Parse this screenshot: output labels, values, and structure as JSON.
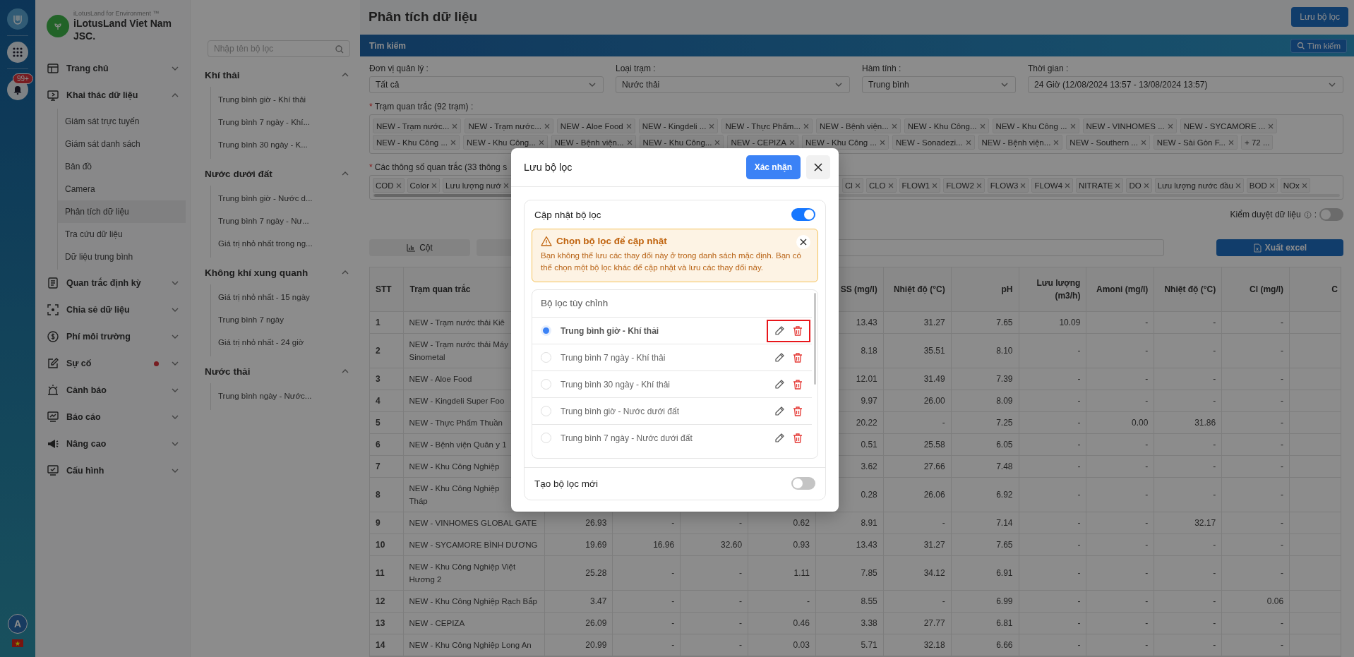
{
  "rail": {
    "badge": "99+",
    "avatar": "A"
  },
  "brand": {
    "tagline": "iLotusLand for Environment ™",
    "name": "iLotusLand Viet Nam JSC."
  },
  "nav": [
    {
      "label": "Trang chủ",
      "expanded": false,
      "alert": false
    },
    {
      "label": "Khai thác dữ liệu",
      "expanded": true,
      "alert": false,
      "children": [
        {
          "label": "Giám sát trực tuyến",
          "selected": false
        },
        {
          "label": "Giám sát danh sách",
          "selected": false
        },
        {
          "label": "Bản đồ",
          "selected": false
        },
        {
          "label": "Camera",
          "selected": false
        },
        {
          "label": "Phân tích dữ liệu",
          "selected": true
        },
        {
          "label": "Tra cứu dữ liệu",
          "selected": false
        },
        {
          "label": "Dữ liệu trung bình",
          "selected": false
        }
      ]
    },
    {
      "label": "Quan trắc định kỳ",
      "expanded": false,
      "alert": false
    },
    {
      "label": "Chia sẻ dữ liệu",
      "expanded": false,
      "alert": false
    },
    {
      "label": "Phí môi trường",
      "expanded": false,
      "alert": false
    },
    {
      "label": "Sự cố",
      "expanded": false,
      "alert": true
    },
    {
      "label": "Cảnh báo",
      "expanded": false,
      "alert": false
    },
    {
      "label": "Báo cáo",
      "expanded": false,
      "alert": false
    },
    {
      "label": "Nâng cao",
      "expanded": false,
      "alert": false
    },
    {
      "label": "Cấu hình",
      "expanded": false,
      "alert": false
    }
  ],
  "filter_panel": {
    "placeholder": "Nhập tên bộ lọc",
    "groups": [
      {
        "title": "Khí thải",
        "expanded": true,
        "items": [
          "Trung bình giờ - Khí thải",
          "Trung bình 7 ngày - Khí...",
          "Trung bình 30 ngày - K..."
        ]
      },
      {
        "title": "Nước dưới đất",
        "expanded": true,
        "items": [
          "Trung bình giờ - Nước d...",
          "Trung bình 7 ngày - Nư...",
          "Giá trị nhỏ nhất trong ng..."
        ]
      },
      {
        "title": "Không khí xung quanh",
        "expanded": true,
        "items": [
          "Giá trị nhỏ nhất - 15 ngày",
          "Trung bình 7 ngày",
          "Giá trị nhỏ nhất - 24 giờ"
        ]
      },
      {
        "title": "Nước thải",
        "expanded": true,
        "items": [
          "Trung bình ngày - Nước..."
        ]
      }
    ]
  },
  "header": {
    "title": "Phân tích dữ liệu",
    "save_button": "Lưu bộ lọc"
  },
  "search_bar": {
    "title": "Tìm kiếm",
    "button": "Tìm kiếm"
  },
  "form": {
    "fields": [
      {
        "label": "Đơn vị quản lý :",
        "value": "Tất cả"
      },
      {
        "label": "Loại trạm :",
        "value": "Nước thải"
      },
      {
        "label": "Hàm tính :",
        "value": "Trung bình"
      },
      {
        "label": "Thời gian :",
        "value": "24 Giờ (12/08/2024 13:57 - 13/08/2024 13:57)"
      }
    ],
    "stations": {
      "mark": "*",
      "label": "Trạm quan trắc (92 trạm) :",
      "chip_rows": [
        [
          "NEW - Trạm nước...",
          "NEW - Trạm nước...",
          "NEW - Aloe Food",
          "NEW - Kingdeli ...",
          "NEW - Thực Phẩm...",
          "NEW - Bệnh viện...",
          "NEW - Khu Công...",
          "NEW - Khu Công ...",
          "NEW - VINHOMES ...",
          "NEW - SYCAMORE ..."
        ],
        [
          "NEW - Khu Công ...",
          "NEW - Khu Công...",
          "NEW - Bệnh viện...",
          "NEW - Khu Công...",
          "NEW - CEPIZA",
          "NEW - Khu Công ...",
          "NEW - Sonadezi...",
          "NEW - Bệnh viện...",
          "NEW - Southern ...",
          "NEW - Sài Gòn F..."
        ]
      ],
      "more": "+ 72 ..."
    },
    "parameters": {
      "mark": "*",
      "label": "Các thông số quan trắc (33 thông s",
      "chips_left": [
        "COD",
        "Color",
        "Lưu lượng nướ"
      ],
      "chips_right": [
        "Cl",
        "CLO",
        "FLOW1",
        "FLOW2",
        "FLOW3",
        "FLOW4",
        "NITRATE",
        "DO",
        "Lưu lượng nước đầu",
        "BOD",
        "NOx"
      ]
    },
    "review": {
      "label": "Kiểm duyệt dữ liệu",
      "colon": ":",
      "on": false
    }
  },
  "toolbar": {
    "column_button": "Cột",
    "export_button": "Xuất excel"
  },
  "table": {
    "columns": [
      "STT",
      "Trạm quan trắc",
      null,
      null,
      null,
      null,
      "SS (mg/l)",
      "Nhiệt độ (°C)",
      "pH",
      "Lưu lượng (m3/h)",
      "Amoni (mg/l)",
      "Nhiệt độ (°C)",
      "Cl (mg/l)",
      "C"
    ],
    "rows": [
      [
        "1",
        "NEW - Trạm nước thải Kiê",
        null,
        null,
        null,
        null,
        "13.43",
        "31.27",
        "7.65",
        "10.09",
        "-",
        "-",
        "-",
        null
      ],
      [
        "2",
        "NEW - Trạm nước thải Máy\nSinometal",
        null,
        null,
        null,
        null,
        "8.18",
        "35.51",
        "8.10",
        "-",
        "-",
        "-",
        "-",
        null
      ],
      [
        "3",
        "NEW - Aloe Food",
        null,
        null,
        null,
        null,
        "12.01",
        "31.49",
        "7.39",
        "-",
        "-",
        "-",
        "-",
        null
      ],
      [
        "4",
        "NEW - Kingdeli Super Foo",
        null,
        null,
        null,
        null,
        "9.97",
        "26.00",
        "8.09",
        "-",
        "-",
        "-",
        "-",
        null
      ],
      [
        "5",
        "NEW - Thực Phẩm Thuần",
        null,
        null,
        null,
        null,
        "20.22",
        "-",
        "7.25",
        "-",
        "0.00",
        "31.86",
        "-",
        null
      ],
      [
        "6",
        "NEW - Bệnh viện Quân y 1",
        null,
        null,
        null,
        null,
        "0.51",
        "25.58",
        "6.05",
        "-",
        "-",
        "-",
        "-",
        null
      ],
      [
        "7",
        "NEW - Khu Công Nghiệp",
        null,
        null,
        null,
        null,
        "3.62",
        "27.66",
        "7.48",
        "-",
        "-",
        "-",
        "-",
        null
      ],
      [
        "8",
        "NEW - Khu Công Nghiệp\nTháp",
        null,
        null,
        null,
        null,
        "0.28",
        "26.06",
        "6.92",
        "-",
        "-",
        "-",
        "-",
        null
      ],
      [
        "9",
        "NEW - VINHOMES GLOBAL GATE",
        "26.93",
        "-",
        "-",
        "0.62",
        "8.91",
        "-",
        "7.14",
        "-",
        "-",
        "32.17",
        "-",
        null
      ],
      [
        "10",
        "NEW - SYCAMORE BÌNH DƯƠNG",
        "19.69",
        "16.96",
        "32.60",
        "0.93",
        "13.43",
        "31.27",
        "7.65",
        "-",
        "-",
        "-",
        "-",
        null
      ],
      [
        "11",
        "NEW - Khu Công Nghiệp Việt\nHương 2",
        "25.28",
        "-",
        "-",
        "1.11",
        "7.85",
        "34.12",
        "6.91",
        "-",
        "-",
        "-",
        "-",
        null
      ],
      [
        "12",
        "NEW - Khu Công Nghiệp Rạch Bắp",
        "3.47",
        "-",
        "-",
        "-",
        "8.55",
        "-",
        "6.99",
        "-",
        "-",
        "-",
        "0.06",
        null
      ],
      [
        "13",
        "NEW - CEPIZA",
        "26.09",
        "-",
        "-",
        "0.46",
        "3.38",
        "27.77",
        "6.81",
        "-",
        "-",
        "-",
        "-",
        null
      ],
      [
        "14",
        "NEW - Khu Công Nghiệp Long An",
        "20.99",
        "-",
        "-",
        "0.03",
        "5.71",
        "32.18",
        "6.66",
        "-",
        "-",
        "-",
        "-",
        null
      ]
    ]
  },
  "modal": {
    "title": "Lưu bộ lọc",
    "confirm": "Xác nhận",
    "update": {
      "label": "Cập nhật bộ lọc",
      "on": true
    },
    "alert": {
      "title": "Chọn bộ lọc để cập nhật",
      "text": "Bạn không thể lưu các thay đổi này ở trong danh sách mặc định. Bạn có thể chọn một bộ lọc khác để cập nhật và lưu các thay đổi này."
    },
    "list": {
      "title": "Bộ lọc tùy chỉnh",
      "items": [
        {
          "name": "Trung bình giờ - Khí thải",
          "selected": true,
          "highlighted": true
        },
        {
          "name": "Trung bình 7 ngày - Khí thải",
          "selected": false,
          "highlighted": false
        },
        {
          "name": "Trung bình 30 ngày - Khí thải",
          "selected": false,
          "highlighted": false
        },
        {
          "name": "Trung bình giờ - Nước dưới đất",
          "selected": false,
          "highlighted": false
        },
        {
          "name": "Trung bình 7 ngày - Nước dưới đất",
          "selected": false,
          "highlighted": false
        }
      ]
    },
    "create": {
      "label": "Tạo bộ lọc mới",
      "on": false
    }
  }
}
